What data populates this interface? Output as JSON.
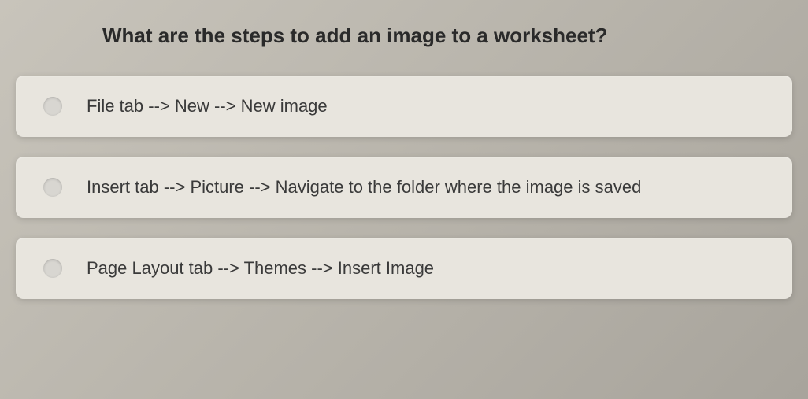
{
  "question": "What are the steps to add an image to a worksheet?",
  "options": [
    {
      "text": "File tab --> New --> New image"
    },
    {
      "text": "Insert tab --> Picture --> Navigate to the folder where the image is saved"
    },
    {
      "text": "Page Layout tab --> Themes --> Insert Image"
    }
  ]
}
